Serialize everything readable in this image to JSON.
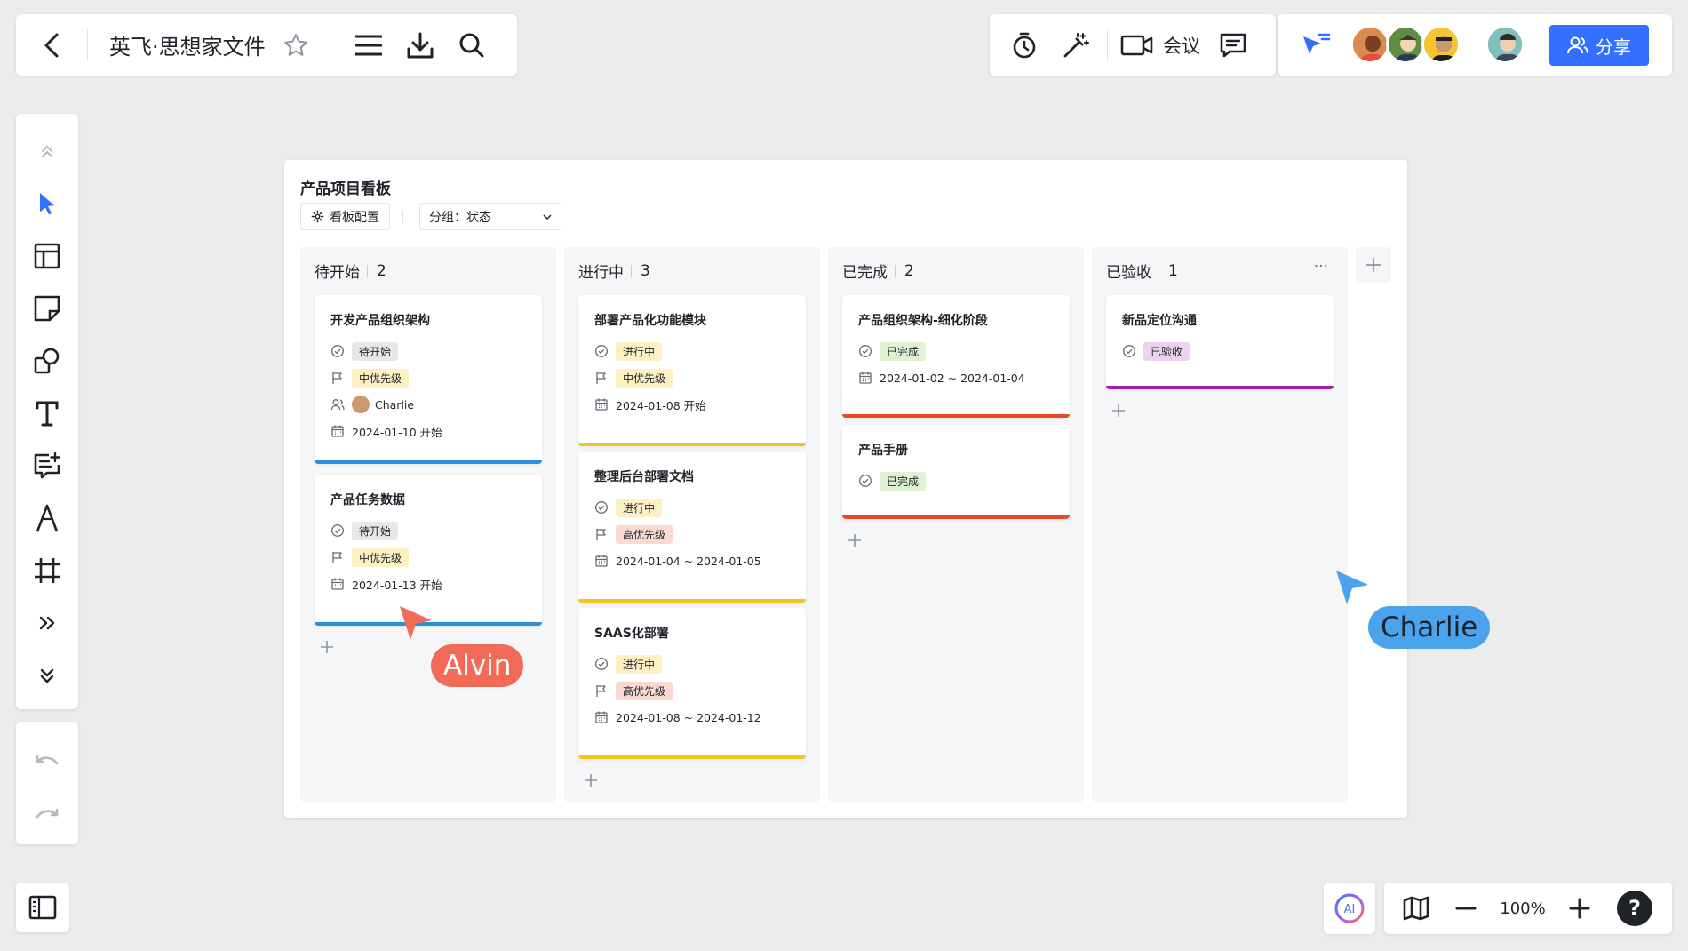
{
  "header": {
    "doc_title": "英飞·思想家文件",
    "meeting_label": "会议",
    "share_label": "分享"
  },
  "board": {
    "title": "产品项目看板",
    "config_label": "看板配置",
    "group_label": "分组：状态",
    "columns": [
      {
        "name": "待开始",
        "count": "2",
        "bar_color": "#2b8fe0",
        "cards": [
          {
            "title": "开发产品组织架构",
            "status": "待开始",
            "priority": "中优先级",
            "assignee": "Charlie",
            "date": "2024-01-10 开始"
          },
          {
            "title": "产品任务数据",
            "status": "待开始",
            "priority": "中优先级",
            "date": "2024-01-13 开始"
          }
        ]
      },
      {
        "name": "进行中",
        "count": "3",
        "bar_color": "#f4c41c",
        "cards": [
          {
            "title": "部署产品化功能模块",
            "status": "进行中",
            "priority": "中优先级",
            "date": "2024-01-08 开始"
          },
          {
            "title": "整理后台部署文档",
            "status": "进行中",
            "priority": "高优先级",
            "date": "2024-01-04 ~ 2024-01-05"
          },
          {
            "title": "SAAS化部署",
            "status": "进行中",
            "priority": "高优先级",
            "date": "2024-01-08 ~ 2024-01-12"
          }
        ]
      },
      {
        "name": "已完成",
        "count": "2",
        "bar_color": "#e8492b",
        "cards": [
          {
            "title": "产品组织架构-细化阶段",
            "status": "已完成",
            "date": "2024-01-02 ~ 2024-01-04"
          },
          {
            "title": "产品手册",
            "status": "已完成"
          }
        ]
      },
      {
        "name": "已验收",
        "count": "1",
        "bar_color": "#9c1fa6",
        "more": "···",
        "cards": [
          {
            "title": "新品定位沟通",
            "status": "已验收"
          }
        ]
      }
    ]
  },
  "tag_colors": {
    "待开始": "#e7e8ea",
    "进行中": "#fdf0c2",
    "已完成": "#dff3d4",
    "已验收": "#ecd2f0",
    "中优先级": "#fdf0c2",
    "高优先级": "#fbd9d3"
  },
  "zoom": {
    "level": "100%"
  },
  "cursors": [
    {
      "name": "Alvin",
      "color": "#f26b58"
    },
    {
      "name": "Charlie",
      "color": "#4aa3ec"
    }
  ],
  "ai_label": "AI",
  "help_label": "?"
}
